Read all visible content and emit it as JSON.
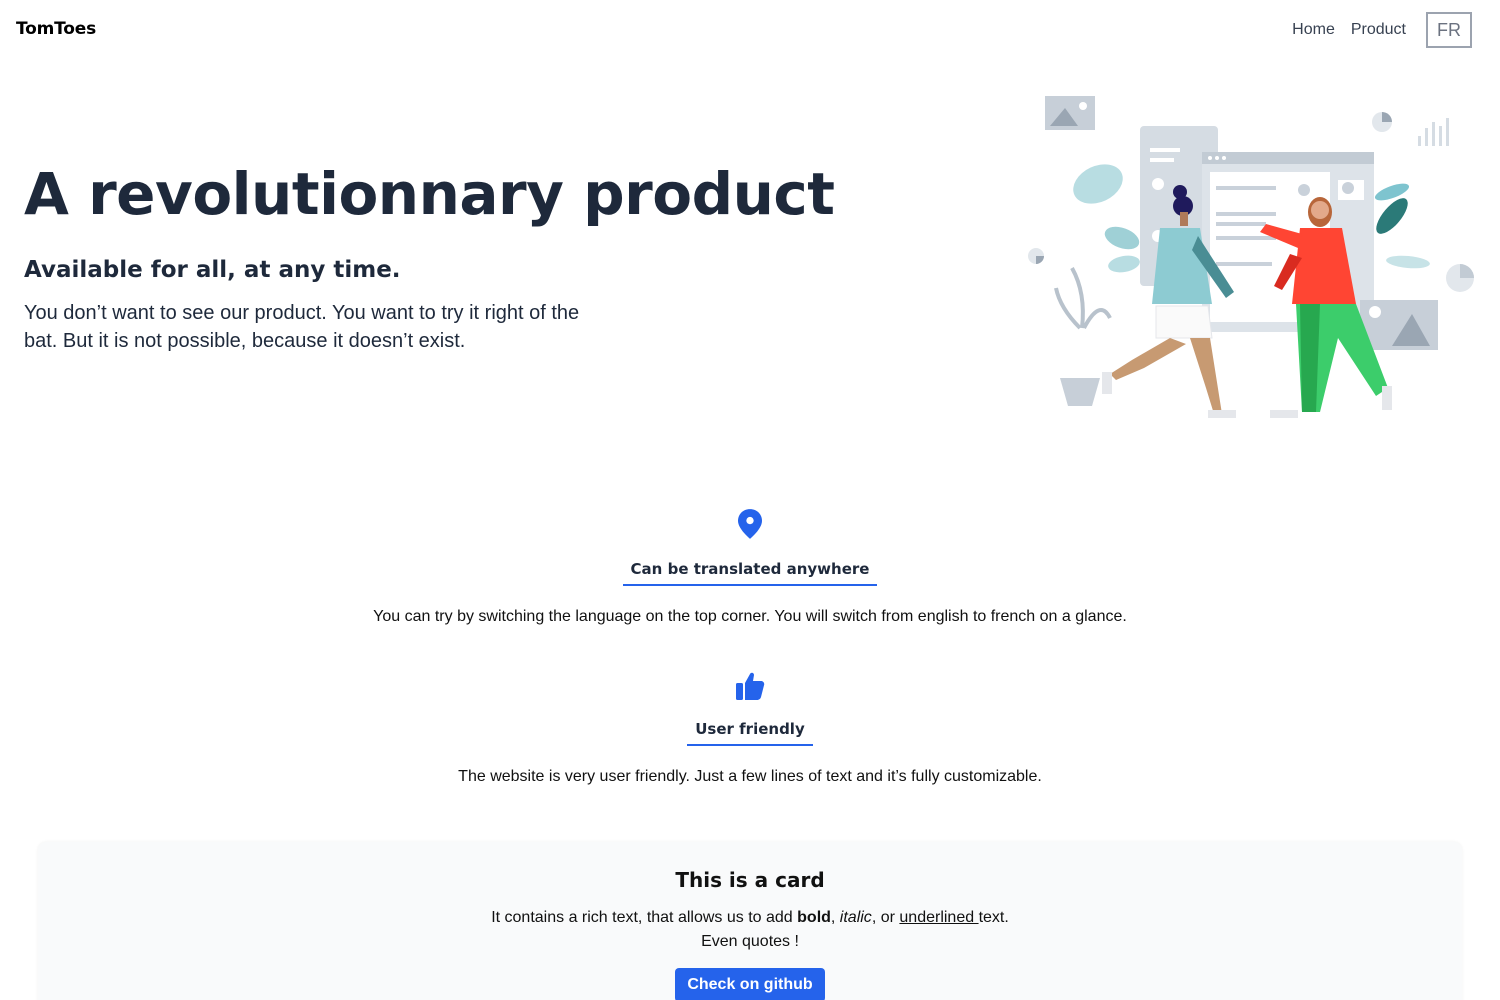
{
  "header": {
    "brand": "TomToes",
    "nav": [
      {
        "label": "Home"
      },
      {
        "label": "Product"
      }
    ],
    "lang_button": "FR"
  },
  "hero": {
    "title": "A revolutionnary product",
    "subtitle": "Available for all, at any time.",
    "text": "You don’t want to see our product. You want to try it right of the bat. But it is not possible, because it doesn’t exist.",
    "illustration_icon": "people-dashboard-illustration"
  },
  "features": [
    {
      "icon": "map-pin-icon",
      "title": "Can be translated anywhere",
      "text": "You can try by switching the language on the top corner. You will switch from english to french on a glance."
    },
    {
      "icon": "thumbs-up-icon",
      "title": "User friendly",
      "text": "The website is very user friendly. Just a few lines of text and it’s fully customizable."
    }
  ],
  "card": {
    "title": "This is a card",
    "text_prefix": "It contains a rich text, that allows us to add",
    "bold": "bold",
    "italic": "italic",
    "sep_or": ", or",
    "underlined": "underlined ",
    "text_suffix": "text.",
    "quote_line": "Even quotes !",
    "button": "Check on github"
  },
  "colors": {
    "accent": "#2563eb",
    "heading": "#1e293b",
    "card_bg": "#f9fafb"
  }
}
